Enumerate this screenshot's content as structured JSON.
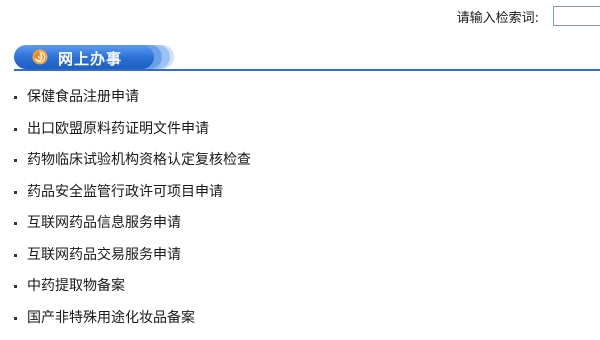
{
  "search": {
    "label": "请输入检索词:",
    "value": "",
    "placeholder": ""
  },
  "section": {
    "title": "网上办事",
    "icon": "swirl-icon",
    "accent_color": "#2f6fc9"
  },
  "services": [
    {
      "label": "保健食品注册申请"
    },
    {
      "label": "出口欧盟原料药证明文件申请"
    },
    {
      "label": "药物临床试验机构资格认定复核检查"
    },
    {
      "label": "药品安全监管行政许可项目申请"
    },
    {
      "label": "互联网药品信息服务申请"
    },
    {
      "label": "互联网药品交易服务申请"
    },
    {
      "label": "中药提取物备案"
    },
    {
      "label": "国产非特殊用途化妆品备案"
    }
  ]
}
